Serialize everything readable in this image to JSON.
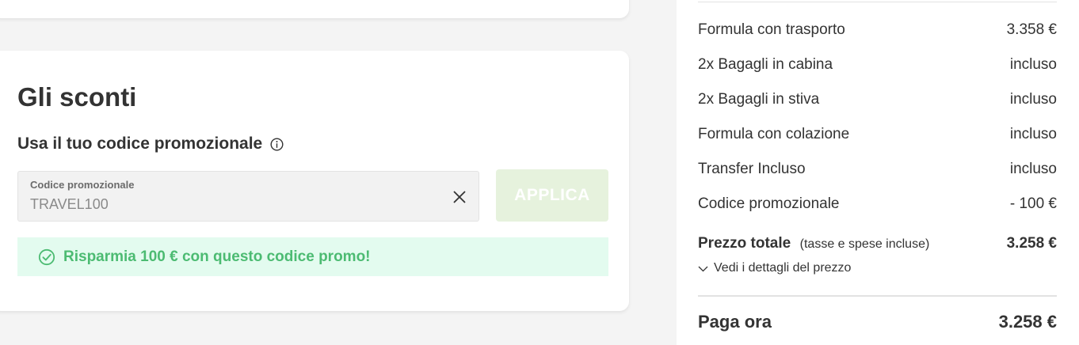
{
  "discounts": {
    "title": "Gli sconti",
    "promo_heading": "Usa il tuo codice promozionale",
    "input": {
      "label": "Codice promozionale",
      "value": "TRAVEL100"
    },
    "apply_label": "APPLICA",
    "success_message": "Risparmia 100 € con questo codice promo!"
  },
  "summary": {
    "rows": [
      {
        "label": "Formula con trasporto",
        "value": "3.358 €"
      },
      {
        "label": "2x Bagagli in cabina",
        "value": "incluso"
      },
      {
        "label": "2x Bagagli in stiva",
        "value": "incluso"
      },
      {
        "label": "Formula con colazione",
        "value": "incluso"
      },
      {
        "label": "Transfer Incluso",
        "value": "incluso"
      },
      {
        "label": "Codice promozionale",
        "value": "- 100 €"
      }
    ],
    "total_label": "Prezzo totale",
    "total_note": "(tasse e spese incluse)",
    "total_value": "3.258 €",
    "details_link": "Vedi i dettagli del prezzo",
    "pay_label": "Paga ora",
    "pay_value": "3.258 €"
  },
  "colors": {
    "success_green": "#4cbb72",
    "success_bg": "#e3fbef",
    "apply_disabled_bg": "#e6f2dd"
  },
  "icons": {
    "info": "info-icon",
    "clear": "close-icon",
    "success": "check-circle-icon",
    "details": "chevron-down-icon"
  }
}
